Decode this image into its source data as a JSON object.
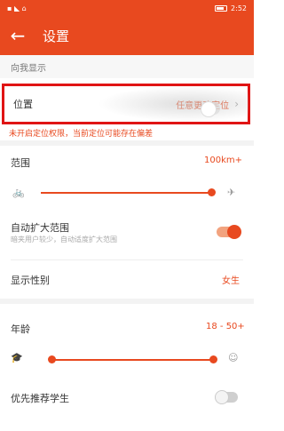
{
  "status_bar": {
    "left": "▪ ◣ ⌂",
    "time": "2:52"
  },
  "header": {
    "title": "设置"
  },
  "section_show_me": "向我显示",
  "location": {
    "label": "位置",
    "value": "任意更改定位",
    "hint": "未开启定位权限，当前定位可能存在偏差"
  },
  "range": {
    "label": "范围",
    "value": "100km+"
  },
  "auto_expand": {
    "label": "自动扩大范围",
    "subtext": "暗夹用户较少，自动适度扩大范围"
  },
  "gender": {
    "label": "显示性别",
    "value": "女生"
  },
  "age": {
    "label": "年龄",
    "value": "18 - 50+"
  },
  "prefer_students": {
    "label": "优先推荐学生"
  },
  "colors": {
    "accent": "#e8491f",
    "highlight_border": "#e01414"
  }
}
